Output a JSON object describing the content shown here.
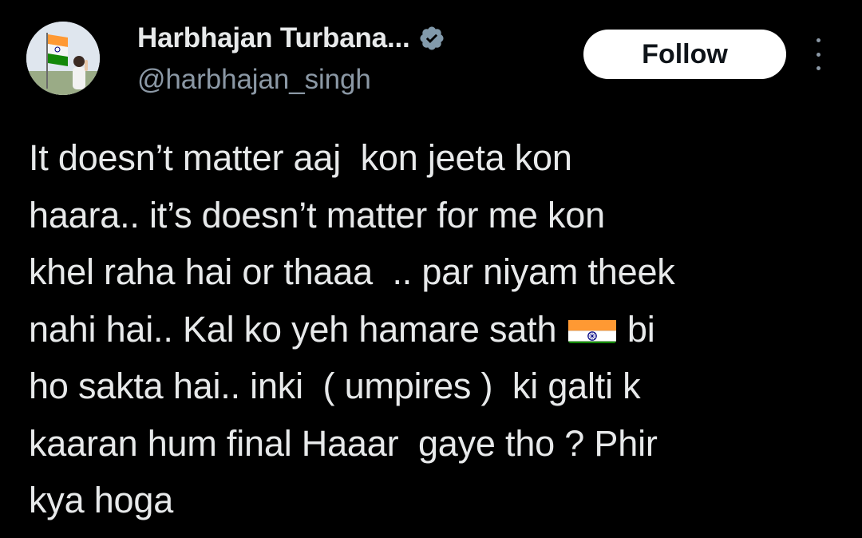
{
  "author": {
    "display_name": "Harbhajan Turbana...",
    "handle": "@harbhajan_singh",
    "verified": true
  },
  "actions": {
    "follow_label": "Follow",
    "more_icon": "more-vertical-icon"
  },
  "tweet": {
    "lines": [
      "It doesn’t matter aaj  kon jeeta kon",
      "haara.. it’s doesn’t matter for me kon",
      "khel raha hai or thaaa  .. par niyam theek",
      "nahi hai.. Kal ko yeh hamare sath ",
      " bi",
      "ho sakta hai.. inki  ( umpires )  ki galti k",
      "kaaran hum final Haaar  gaye tho ? Phir",
      "kya hoga"
    ],
    "emoji": "india-flag"
  },
  "colors": {
    "background": "#000000",
    "text_primary": "#e7e9ea",
    "text_secondary": "#8b98a5",
    "follow_bg": "#ffffff",
    "follow_text": "#0f1419",
    "verified_badge": "#829aab"
  }
}
